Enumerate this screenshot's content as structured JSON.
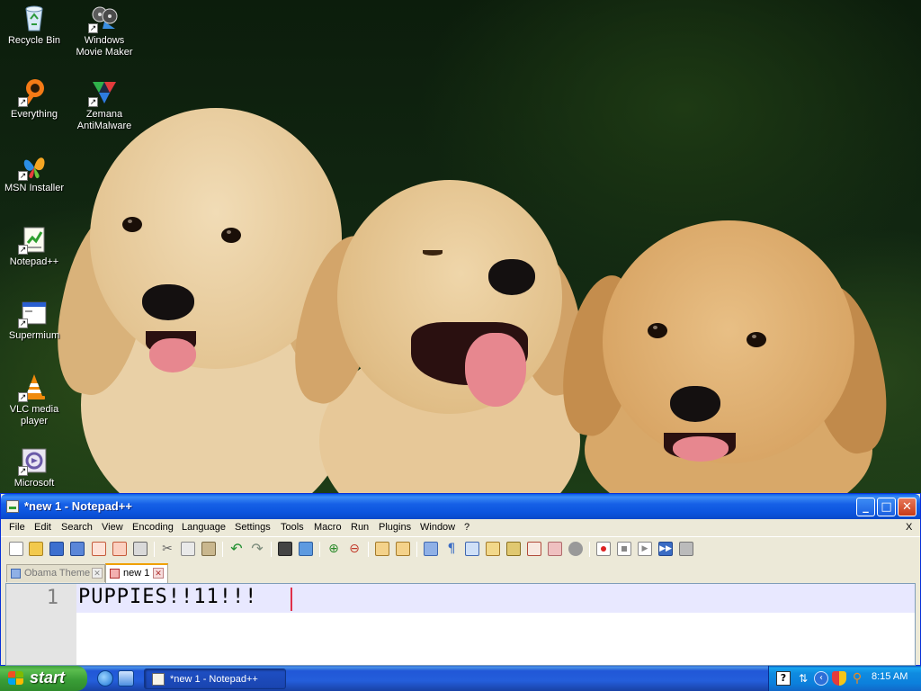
{
  "desktop": {
    "icons": [
      {
        "label": "Recycle Bin",
        "icon": "recycle-bin-icon"
      },
      {
        "label": "Windows Movie Maker",
        "icon": "movie-maker-icon"
      },
      {
        "label": "Everything",
        "icon": "everything-icon"
      },
      {
        "label": "Zemana AntiMalware",
        "icon": "zemana-icon"
      },
      {
        "label": "MSN Installer",
        "icon": "msn-butterfly-icon"
      },
      {
        "label": "Notepad++",
        "icon": "notepad-plus-plus-icon"
      },
      {
        "label": "Supermium",
        "icon": "supermium-icon"
      },
      {
        "label": "VLC media player",
        "icon": "vlc-cone-icon"
      },
      {
        "label": "Microsoft",
        "icon": "microsoft-app-icon"
      }
    ],
    "wallpaper": "three golden retriever puppies"
  },
  "window": {
    "title": "*new 1 - Notepad++",
    "menu": [
      "File",
      "Edit",
      "Search",
      "View",
      "Encoding",
      "Language",
      "Settings",
      "Tools",
      "Macro",
      "Run",
      "Plugins",
      "Window",
      "?"
    ],
    "menu_close": "X",
    "tabs": [
      {
        "label": "Obama Theme",
        "active": false
      },
      {
        "label": "new 1",
        "active": true
      }
    ],
    "editor": {
      "line_number": "1",
      "content": "PUPPIES!!11!!!"
    }
  },
  "taskbar": {
    "start_label": "start",
    "task_label": "*new 1 - Notepad++",
    "clock": "8:15 AM"
  },
  "colors": {
    "titlebar": "#0b54de",
    "taskbar": "#245edb",
    "start": "#3a9e37",
    "tab_active_accent": "#f0a000"
  }
}
